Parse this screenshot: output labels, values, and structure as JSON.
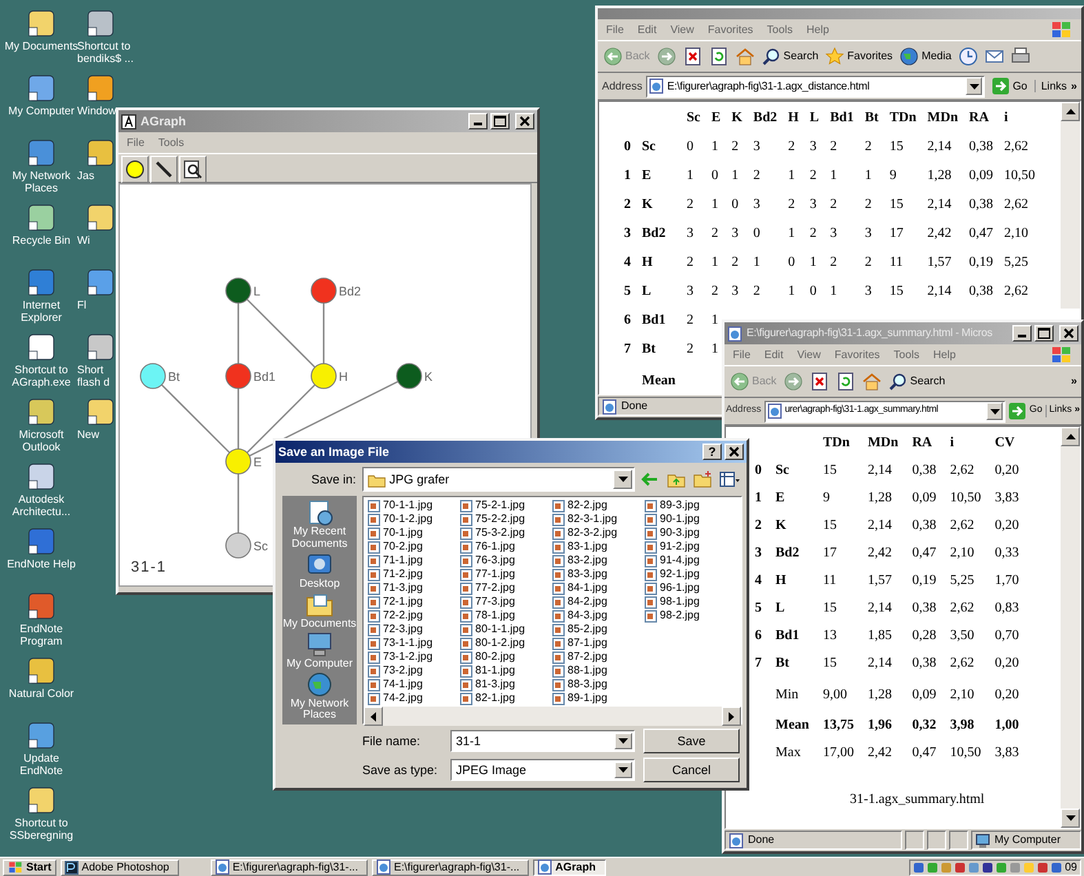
{
  "desktop": {
    "icons": [
      "My Documents",
      "My Computer",
      "My Network Places",
      "Recycle Bin",
      "Internet Explorer",
      "Shortcut to AGraph.exe",
      "Microsoft Outlook",
      "Autodesk Architectu...",
      "EndNote Help",
      "EndNote Program",
      "Natural Color",
      "Update EndNote",
      "Shortcut to SSberegning"
    ],
    "icons_column_2": [
      "Shortcut to bendiks$ ...",
      "Window",
      "Jas",
      "Wi",
      "Fl",
      "Short flash d",
      "New"
    ]
  },
  "agraph": {
    "title": "AGraph",
    "active": false,
    "menu": [
      "File",
      "Tools"
    ],
    "nodes": [
      {
        "label": "L",
        "color": "#0d5c1e"
      },
      {
        "label": "Bd2",
        "color": "#f0321e"
      },
      {
        "label": "Bt",
        "color": "#6cf4f4"
      },
      {
        "label": "Bd1",
        "color": "#f0321e"
      },
      {
        "label": "H",
        "color": "#f8f000"
      },
      {
        "label": "K",
        "color": "#0d5c1e"
      },
      {
        "label": "E",
        "color": "#f8f000"
      },
      {
        "label": "Sc",
        "color": "#d0d0d0"
      }
    ],
    "caption": "31-1"
  },
  "browser_distance": {
    "menu": [
      "File",
      "Edit",
      "View",
      "Favorites",
      "Tools",
      "Help"
    ],
    "toolbar": [
      {
        "kind": "back",
        "label": "Back"
      },
      {
        "kind": "forward"
      },
      {
        "kind": "stop"
      },
      {
        "kind": "refresh"
      },
      {
        "kind": "home"
      },
      {
        "kind": "search",
        "label": "Search"
      },
      {
        "kind": "favorites",
        "label": "Favorites"
      },
      {
        "kind": "media",
        "label": "Media"
      },
      {
        "kind": "history"
      },
      {
        "kind": "mail"
      },
      {
        "kind": "print"
      }
    ],
    "address_label": "Address",
    "address": "E:\\figurer\\agraph-fig\\31-1.agx_distance.html",
    "go": "Go",
    "links": "Links",
    "links_more": "»",
    "table": {
      "columns": [
        "Sc",
        "E",
        "K",
        "Bd2",
        "H",
        "L",
        "Bd1",
        "Bt",
        "TDn",
        "MDn",
        "RA",
        "i"
      ],
      "rows": [
        {
          "kind": "data",
          "index": "0",
          "name": "Sc",
          "values": [
            "0",
            "1",
            "2",
            "3",
            "2",
            "3",
            "2",
            "2",
            "15",
            "2,14",
            "0,38",
            "2,62"
          ]
        },
        {
          "kind": "data",
          "index": "1",
          "name": "E",
          "values": [
            "1",
            "0",
            "1",
            "2",
            "1",
            "2",
            "1",
            "1",
            "9",
            "1,28",
            "0,09",
            "10,50"
          ]
        },
        {
          "kind": "data",
          "index": "2",
          "name": "K",
          "values": [
            "2",
            "1",
            "0",
            "3",
            "2",
            "3",
            "2",
            "2",
            "15",
            "2,14",
            "0,38",
            "2,62"
          ]
        },
        {
          "kind": "data",
          "index": "3",
          "name": "Bd2",
          "values": [
            "3",
            "2",
            "3",
            "0",
            "1",
            "2",
            "3",
            "3",
            "17",
            "2,42",
            "0,47",
            "2,10"
          ]
        },
        {
          "kind": "data",
          "index": "4",
          "name": "H",
          "values": [
            "2",
            "1",
            "2",
            "1",
            "0",
            "1",
            "2",
            "2",
            "11",
            "1,57",
            "0,19",
            "5,25"
          ]
        },
        {
          "kind": "data",
          "index": "5",
          "name": "L",
          "values": [
            "3",
            "2",
            "3",
            "2",
            "1",
            "0",
            "1",
            "3",
            "15",
            "2,14",
            "0,38",
            "2,62"
          ]
        },
        {
          "kind": "data",
          "index": "6",
          "name": "Bd1",
          "values": [
            "2",
            "1"
          ]
        },
        {
          "kind": "data",
          "index": "7",
          "name": "Bt",
          "values": [
            "2",
            "1"
          ]
        },
        {
          "kind": "summary",
          "label": "Mean",
          "emphasis": true
        }
      ]
    },
    "status": [
      "Done"
    ]
  },
  "browser_summary": {
    "title": "E:\\figurer\\agraph-fig\\31-1.agx_summary.html - Micros",
    "active": false,
    "menu": [
      "File",
      "Edit",
      "View",
      "Favorites",
      "Tools",
      "Help"
    ],
    "toolbar": [
      {
        "kind": "back",
        "label": "Back"
      },
      {
        "kind": "forward"
      },
      {
        "kind": "stop"
      },
      {
        "kind": "refresh"
      },
      {
        "kind": "home"
      },
      {
        "kind": "search",
        "label": "Search"
      }
    ],
    "toolbar_more": "»",
    "address_label": "Address",
    "address": "urer\\agraph-fig\\31-1.agx_summary.html",
    "go": "Go",
    "links": "Links",
    "links_more": "»",
    "table": {
      "columns": [
        "TDn",
        "MDn",
        "RA",
        "i",
        "CV"
      ],
      "rows": [
        {
          "kind": "data",
          "index": "0",
          "name": "Sc",
          "values": [
            "15",
            "2,14",
            "0,38",
            "2,62",
            "0,20"
          ]
        },
        {
          "kind": "data",
          "index": "1",
          "name": "E",
          "values": [
            "9",
            "1,28",
            "0,09",
            "10,50",
            "3,83"
          ]
        },
        {
          "kind": "data",
          "index": "2",
          "name": "K",
          "values": [
            "15",
            "2,14",
            "0,38",
            "2,62",
            "0,20"
          ]
        },
        {
          "kind": "data",
          "index": "3",
          "name": "Bd2",
          "values": [
            "17",
            "2,42",
            "0,47",
            "2,10",
            "0,33"
          ]
        },
        {
          "kind": "data",
          "index": "4",
          "name": "H",
          "values": [
            "11",
            "1,57",
            "0,19",
            "5,25",
            "1,70"
          ]
        },
        {
          "kind": "data",
          "index": "5",
          "name": "L",
          "values": [
            "15",
            "2,14",
            "0,38",
            "2,62",
            "0,83"
          ]
        },
        {
          "kind": "data",
          "index": "6",
          "name": "Bd1",
          "values": [
            "13",
            "1,85",
            "0,28",
            "3,50",
            "0,70"
          ]
        },
        {
          "kind": "data",
          "index": "7",
          "name": "Bt",
          "values": [
            "15",
            "2,14",
            "0,38",
            "2,62",
            "0,20"
          ]
        },
        {
          "kind": "summary",
          "label": "Min",
          "emphasis": false,
          "values": [
            "9,00",
            "1,28",
            "0,09",
            "2,10",
            "0,20"
          ]
        },
        {
          "kind": "summary",
          "label": "Mean",
          "emphasis": true,
          "values": [
            "13,75",
            "1,96",
            "0,32",
            "3,98",
            "1,00"
          ]
        },
        {
          "kind": "summary",
          "label": "Max",
          "emphasis": false,
          "values": [
            "17,00",
            "2,42",
            "0,47",
            "10,50",
            "3,83"
          ]
        }
      ]
    },
    "footer": "31-1.agx_summary.html",
    "status": [
      "Done",
      "My Computer"
    ]
  },
  "save_dialog": {
    "title": "Save an Image File",
    "active": true,
    "help": "?",
    "save_in_label": "Save in:",
    "folder": "JPG grafer",
    "places": [
      "My Recent Documents",
      "Desktop",
      "My Documents",
      "My Computer",
      "My Network Places"
    ],
    "files": [
      "70-1-1.jpg",
      "70-1-2.jpg",
      "70-1.jpg",
      "70-2.jpg",
      "71-1.jpg",
      "71-2.jpg",
      "71-3.jpg",
      "72-1.jpg",
      "72-2.jpg",
      "72-3.jpg",
      "73-1-1.jpg",
      "73-1-2.jpg",
      "73-2.jpg",
      "74-1.jpg",
      "74-2.jpg",
      "75-2-1.jpg",
      "75-2-2.jpg",
      "75-3-2.jpg",
      "76-1.jpg",
      "76-3.jpg",
      "77-1.jpg",
      "77-2.jpg",
      "77-3.jpg",
      "78-1.jpg",
      "80-1-1.jpg",
      "80-1-2.jpg",
      "80-2.jpg",
      "81-1.jpg",
      "81-3.jpg",
      "82-1.jpg",
      "82-2.jpg",
      "82-3-1.jpg",
      "82-3-2.jpg",
      "83-1.jpg",
      "83-2.jpg",
      "83-3.jpg",
      "84-1.jpg",
      "84-2.jpg",
      "84-3.jpg",
      "85-2.jpg",
      "87-1.jpg",
      "87-2.jpg",
      "88-1.jpg",
      "88-3.jpg",
      "89-1.jpg",
      "89-3.jpg",
      "90-1.jpg",
      "90-3.jpg",
      "91-2.jpg",
      "91-4.jpg",
      "92-1.jpg",
      "96-1.jpg",
      "98-1.jpg",
      "98-2.jpg"
    ],
    "file_name_label": "File name:",
    "file_name": "31-1",
    "type_label": "Save as type:",
    "type": "JPEG Image",
    "buttons": [
      "Save",
      "Cancel"
    ]
  },
  "taskbar": {
    "start": "Start",
    "tasks": [
      {
        "label": "Adobe Photoshop",
        "selected": false
      },
      {
        "label": "E:\\figurer\\agraph-fig\\31-...",
        "selected": false
      },
      {
        "label": "E:\\figurer\\agraph-fig\\31-...",
        "selected": false
      },
      {
        "label": "AGraph",
        "selected": true
      }
    ],
    "clock": "09"
  }
}
